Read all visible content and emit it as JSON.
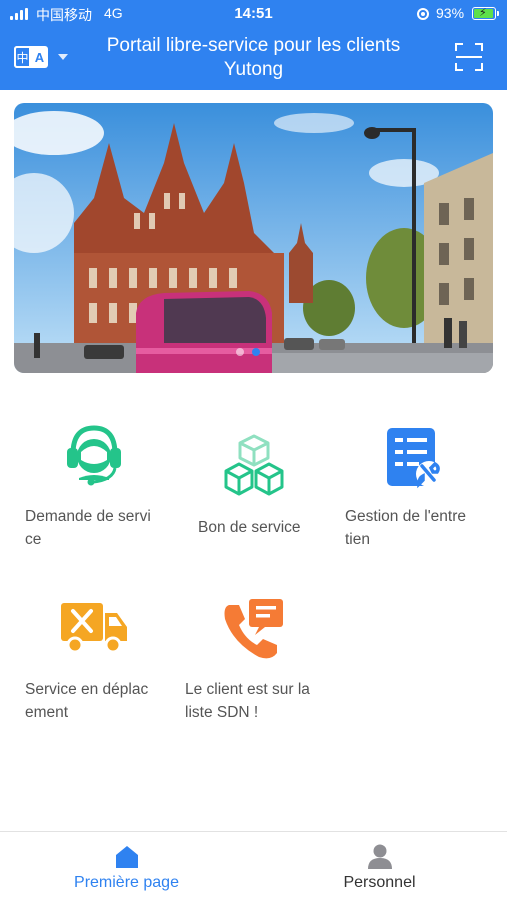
{
  "status_bar": {
    "carrier": "中国移动",
    "network": "4G",
    "time": "14:51",
    "battery": "93%"
  },
  "header": {
    "lang_cn": "中",
    "lang_en": "A",
    "title_line1": "Portail libre-service pour les clients",
    "title_line2": "Yutong"
  },
  "banner": {
    "slide_count": 2,
    "active_slide": 2
  },
  "services": [
    {
      "line1": "Demande de servi",
      "line2": "ce",
      "icon": "customer-service-headset-icon"
    },
    {
      "line1": "Bon de service",
      "line2": "",
      "icon": "cubes-icon"
    },
    {
      "line1": "Gestion de l'entre",
      "line2": "tien",
      "icon": "maintenance-document-wrench-icon"
    },
    {
      "line1": "Service en déplac",
      "line2": "ement",
      "icon": "service-truck-icon"
    },
    {
      "line1": "Le client est sur la",
      "line2": "liste SDN !",
      "icon": "phone-message-icon"
    }
  ],
  "tabbar": {
    "home": "Première page",
    "personal": "Personnel"
  },
  "colors": {
    "primary": "#2f82f0",
    "green": "#24c48a",
    "orange": "#f5a623",
    "coral": "#f57b35",
    "tab_inactive": "#333333",
    "text": "#555555"
  }
}
